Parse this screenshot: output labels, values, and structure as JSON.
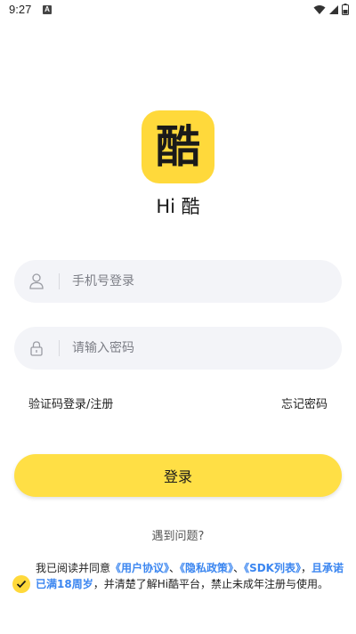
{
  "status_bar": {
    "time": "9:27",
    "notification_icon": "A",
    "icons": [
      "wifi-icon",
      "signal-icon",
      "battery-icon"
    ]
  },
  "app": {
    "logo_glyph": "酷",
    "name": "Hi 酷",
    "brand_color": "#ffd93b"
  },
  "form": {
    "phone_placeholder": "手机号登录",
    "phone_value": "",
    "password_placeholder": "请输入密码",
    "password_value": "",
    "user_icon": "user-icon",
    "lock_icon": "lock-icon"
  },
  "links": {
    "sms_login": "验证码登录/注册",
    "forgot_password": "忘记密码"
  },
  "login_button": "登录",
  "help_link": "遇到问题?",
  "agreement": {
    "checked": true,
    "prefix": "我已阅读并同意",
    "user_agreement": "《用户协议》",
    "sep1": "、",
    "privacy_policy": "《隐私政策》",
    "sep2": "、",
    "sdk_list": "《SDK列表》",
    "comma": "，",
    "age_confirm": "且承诺已满18周岁",
    "suffix": "，并清楚了解Hi酷平台，禁止未成年注册与使用。"
  }
}
